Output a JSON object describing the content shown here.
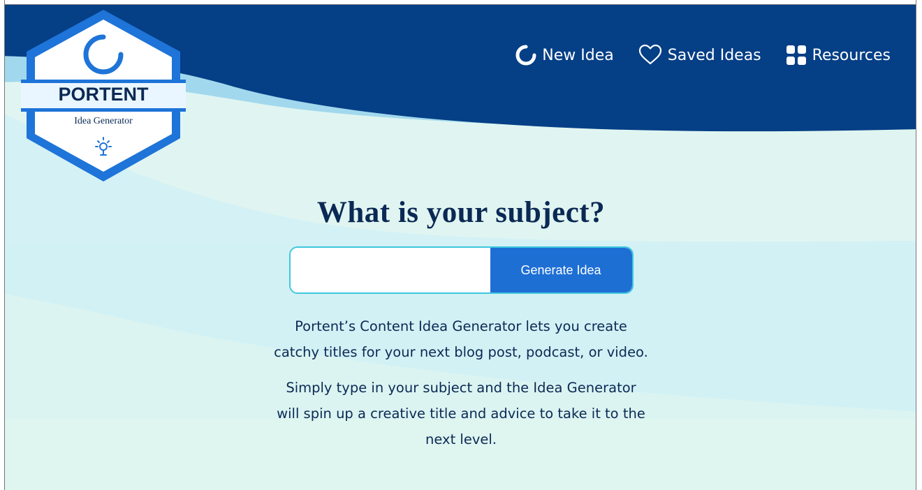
{
  "logo": {
    "brand": "PORTENT",
    "subtitle": "Idea Generator"
  },
  "nav": {
    "new_idea": "New Idea",
    "saved_ideas": "Saved Ideas",
    "resources": "Resources"
  },
  "hero": {
    "title": "What is your subject?",
    "input_value": "",
    "input_placeholder": "",
    "button_label": "Generate Idea",
    "paragraph1_line1": "Portent’s Content Idea Generator lets you create",
    "paragraph1_line2": "catchy titles for your next blog post, podcast, or video.",
    "paragraph2_line1": "Simply type in your subject and the Idea Generator",
    "paragraph2_line2": "will spin up a creative title and advice to take it to the",
    "paragraph2_line3": "next level."
  },
  "colors": {
    "header_navy": "#053f86",
    "light_cyan": "#d7f3f4",
    "cyan_band": "#c8eef3",
    "button_blue": "#1e6fd4",
    "input_border": "#3ec7dd",
    "title_text": "#0b2954"
  },
  "icons": [
    "new-idea-ring-icon",
    "heart-icon",
    "grid-icon",
    "lightbulb-icon",
    "portent-ring-icon"
  ]
}
